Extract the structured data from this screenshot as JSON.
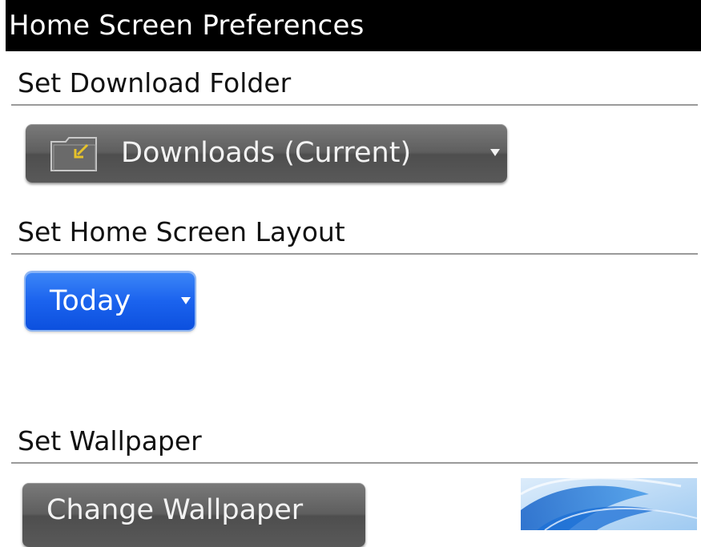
{
  "header": {
    "title": "Home Screen Preferences"
  },
  "download_folder": {
    "section_label": "Set Download Folder",
    "selected_value": "Downloads (Current)",
    "icon": "folder-download-icon"
  },
  "layout": {
    "section_label": "Set Home Screen Layout",
    "selected_value": "Today"
  },
  "wallpaper": {
    "section_label": "Set Wallpaper",
    "button_label": "Change Wallpaper",
    "preview": "wallpaper-thumbnail"
  },
  "colors": {
    "title_bar": "#000000",
    "dark_button": "#5e5e5e",
    "focused_dropdown": "#1b63ee"
  }
}
